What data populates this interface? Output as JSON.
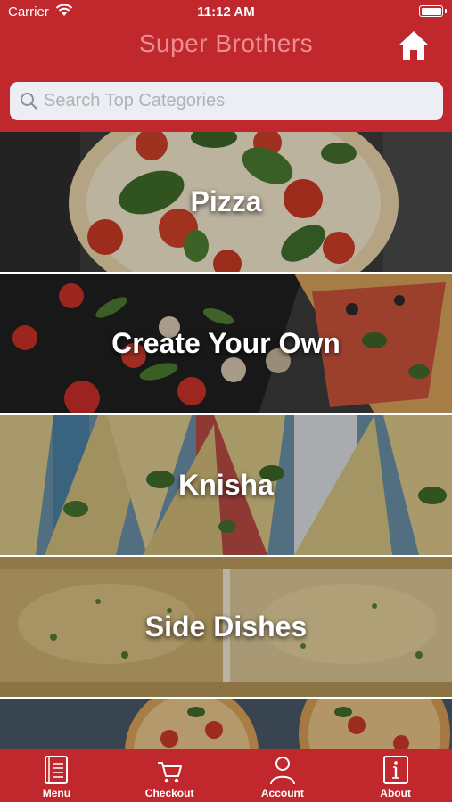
{
  "status_bar": {
    "carrier": "Carrier",
    "time": "11:12 AM"
  },
  "header": {
    "title": "Super Brothers",
    "home_icon": "home-icon"
  },
  "search": {
    "placeholder": "Search Top Categories",
    "value": ""
  },
  "categories": [
    {
      "label": "Pizza"
    },
    {
      "label": "Create Your Own"
    },
    {
      "label": "Knisha"
    },
    {
      "label": "Side Dishes"
    },
    {
      "label": ""
    }
  ],
  "tabs": [
    {
      "label": "Menu",
      "icon": "menu-book-icon"
    },
    {
      "label": "Checkout",
      "icon": "cart-icon"
    },
    {
      "label": "Account",
      "icon": "person-icon"
    },
    {
      "label": "About",
      "icon": "info-icon"
    }
  ],
  "colors": {
    "brand_red": "#c0282e",
    "title_pink": "#ec8d8f",
    "search_bg": "#eceef3"
  }
}
